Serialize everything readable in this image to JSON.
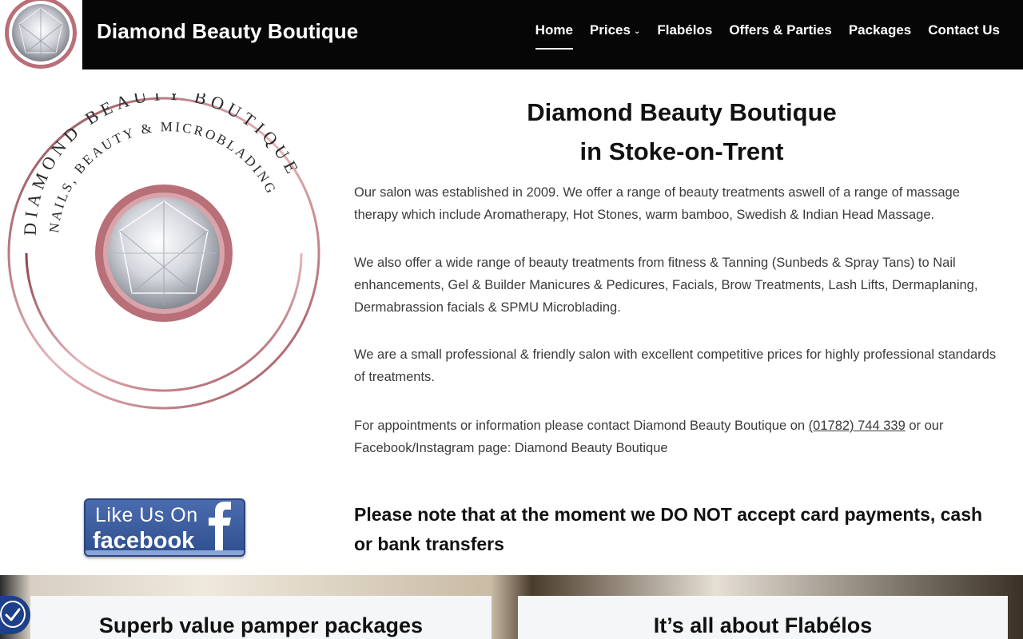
{
  "header": {
    "site_title": "Diamond Beauty Boutique",
    "nav": [
      {
        "label": "Home",
        "active": true,
        "has_dropdown": false
      },
      {
        "label": "Prices",
        "active": false,
        "has_dropdown": true
      },
      {
        "label": "Flabélos",
        "active": false,
        "has_dropdown": false
      },
      {
        "label": "Offers & Parties",
        "active": false,
        "has_dropdown": false
      },
      {
        "label": "Packages",
        "active": false,
        "has_dropdown": false
      },
      {
        "label": "Contact Us",
        "active": false,
        "has_dropdown": false
      }
    ]
  },
  "logo": {
    "arc_top": "DIAMOND BEAUTY BOUTIQUE",
    "arc_inner": "NAILS, BEAUTY & MICROBLADING"
  },
  "main": {
    "heading_line1": "Diamond Beauty Boutique",
    "heading_line2": "in Stoke-on-Trent",
    "p1": "Our salon was established in 2009. We offer a range of beauty treatments aswell of a range of massage therapy which include Aromatherapy, Hot Stones, warm bamboo, Swedish & Indian Head Massage.",
    "p2": "We also offer a wide range of beauty treatments from fitness & Tanning (Sunbeds & Spray Tans) to Nail enhancements, Gel & Builder Manicures & Pedicures, Facials, Brow Treatments, Lash Lifts, Dermaplaning, Dermabrassion facials & SPMU Microblading.",
    "p3": "We are a small professional & friendly salon with excellent competitive prices for highly professional standards of treatments.",
    "p4_before": "For appointments or information please contact Diamond Beauty Boutique on ",
    "phone": "(01782) 744 339",
    "p4_after": " or our Facebook/Instagram page: Diamond Beauty Boutique",
    "notice": "Please note that at the moment we DO NOT accept card payments, cash or bank transfers"
  },
  "facebook_badge": {
    "line1": "Like Us On",
    "line2": "facebook"
  },
  "cards": [
    {
      "title": "Superb value pamper packages"
    },
    {
      "title": "It’s all about Flabélos"
    }
  ],
  "colors": {
    "header_bg": "#060606",
    "rose_gold": "#b86f78",
    "facebook_blue": "#3b5998",
    "accessibility_blue": "#1e3f8a"
  }
}
